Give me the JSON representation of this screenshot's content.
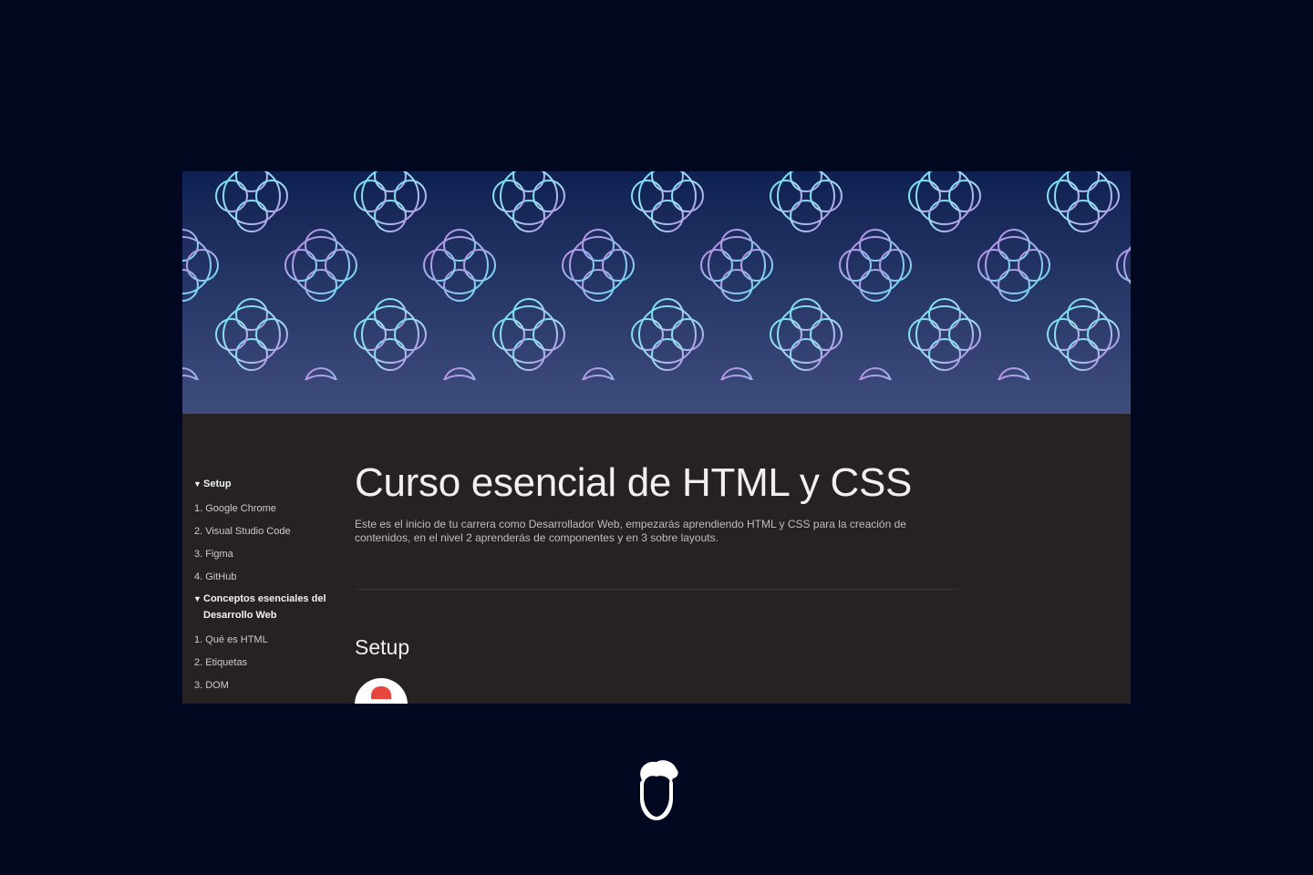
{
  "sidebar": {
    "groups": [
      {
        "title": "Setup",
        "toggle_icon": "▼",
        "items": [
          "1. Google Chrome",
          "2. Visual Studio Code",
          "3. Figma",
          "4. GitHub"
        ]
      },
      {
        "title": "Conceptos esenciales del Desarrollo Web",
        "toggle_icon": "▼",
        "items": [
          "1. Qué es HTML",
          "2. Etiquetas",
          "3. DOM"
        ]
      }
    ]
  },
  "main": {
    "title": "Curso esencial de HTML y CSS",
    "description": "Este es el inicio de tu carrera como Desarrollador Web, empezarás aprendiendo HTML y CSS para la creación de contenidos, en el nivel 2 aprenderás de componentes y en 3 sobre layouts.",
    "section_title": "Setup"
  },
  "colors": {
    "background": "#020820",
    "page": "#262223",
    "cover_top": "#0f2152",
    "cover_bottom": "#3f4d7d",
    "pattern_cyan": "#6fe3f2",
    "pattern_violet": "#b88ae6"
  },
  "icons": {
    "cover": "geometric-pattern-cover",
    "chrome": "google-chrome-icon",
    "logo": "bearded-man-logo-icon"
  }
}
